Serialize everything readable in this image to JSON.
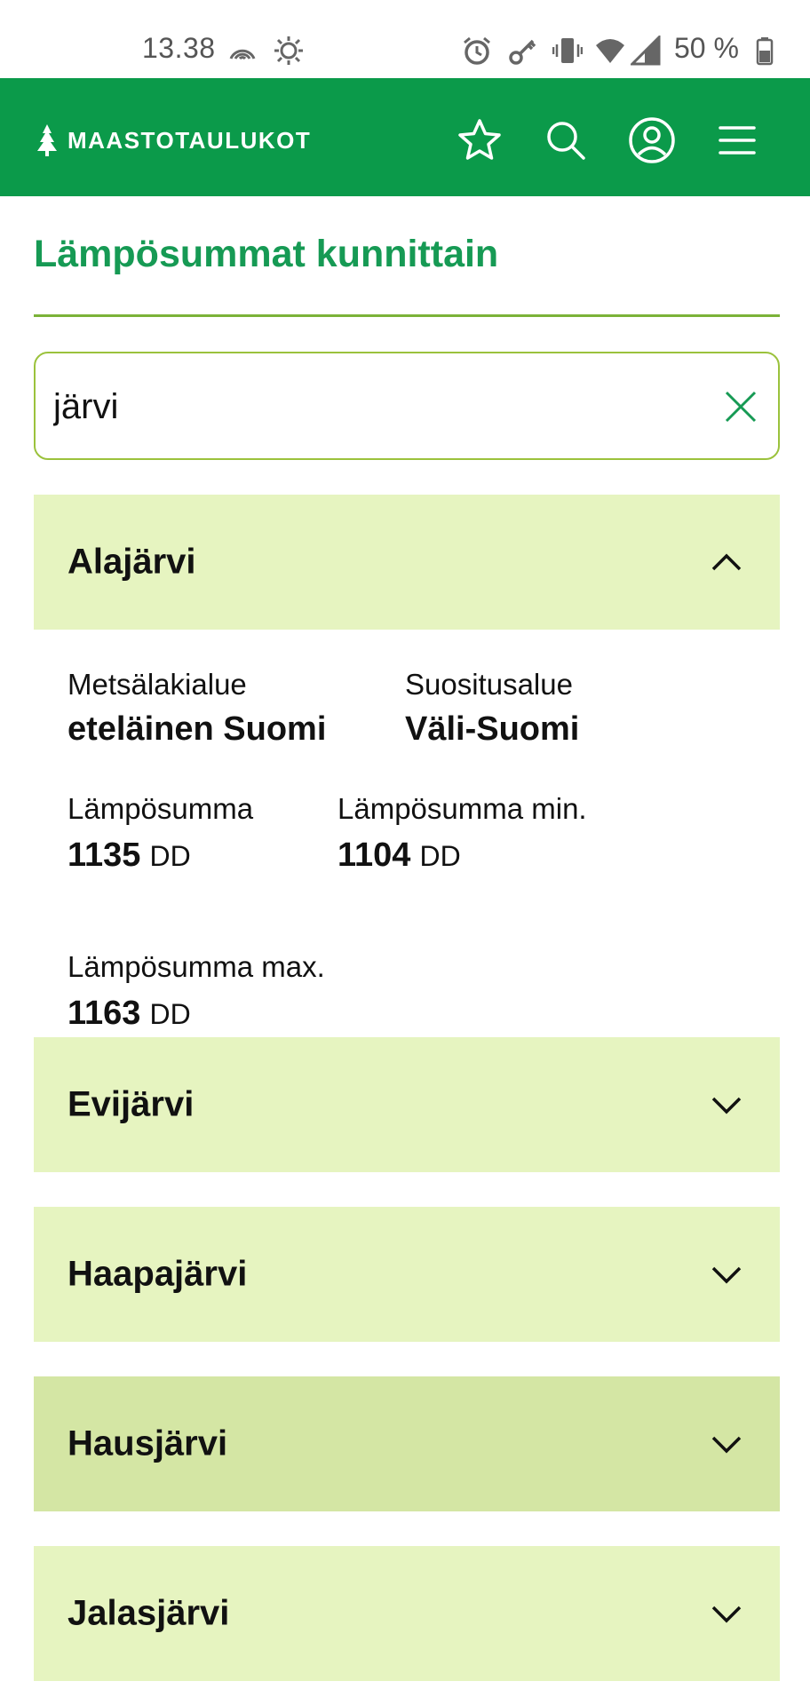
{
  "status_bar": {
    "time": "13.38",
    "battery": "50 %",
    "icons": [
      "nfc-icon",
      "brightness-icon",
      "alarm-icon",
      "key-icon",
      "vibrate-icon",
      "wifi-icon",
      "signal-icon",
      "battery-icon"
    ]
  },
  "app_bar": {
    "logo_text": "MAASTOTAULUKOT",
    "actions": [
      "star-icon",
      "search-icon",
      "account-icon",
      "menu-icon"
    ],
    "color": "#0b9a4a"
  },
  "page": {
    "title": "Lämpösummat kunnittain",
    "title_color": "#169a54"
  },
  "search": {
    "value": "järvi",
    "placeholder": ""
  },
  "expanded": {
    "name": "Alajärvi",
    "metsalakialue_label": "Metsälakialue",
    "metsalakialue_value": "eteläinen Suomi",
    "suositusalue_label": "Suositusalue",
    "suositusalue_value": "Väli-Suomi",
    "lampo_label": "Lämpösumma",
    "lampo_value": "1135",
    "lampo_min_label": "Lämpösumma min.",
    "lampo_min_value": "1104",
    "lampo_max_label": "Lämpösumma max.",
    "lampo_max_value": "1163",
    "unit": "DD"
  },
  "collapsed_items": [
    {
      "name": "Evijärvi"
    },
    {
      "name": "Haapajärvi"
    },
    {
      "name": "Hausjärvi"
    },
    {
      "name": "Jalasjärvi"
    }
  ],
  "colors": {
    "accordion_bg": "#e6f4c0",
    "accordion_hover_bg": "#d4e6a4",
    "rule": "#7bb238"
  }
}
